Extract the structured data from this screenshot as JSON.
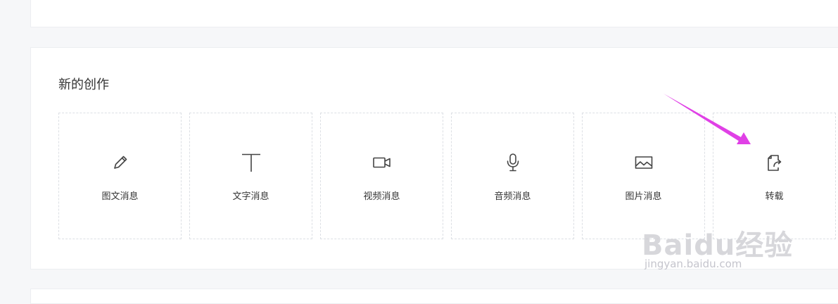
{
  "section": {
    "title": "新的创作"
  },
  "cards": [
    {
      "label": "图文消息",
      "icon": "pencil-icon"
    },
    {
      "label": "文字消息",
      "icon": "text-t-icon"
    },
    {
      "label": "视频消息",
      "icon": "video-camera-icon"
    },
    {
      "label": "音频消息",
      "icon": "microphone-icon"
    },
    {
      "label": "图片消息",
      "icon": "image-icon"
    },
    {
      "label": "转载",
      "icon": "share-forward-icon"
    }
  ],
  "annotation": {
    "arrow_color": "#e040e6"
  },
  "watermark": {
    "logo_text": "Baidu经验",
    "url": "jingyan.baidu.com"
  }
}
